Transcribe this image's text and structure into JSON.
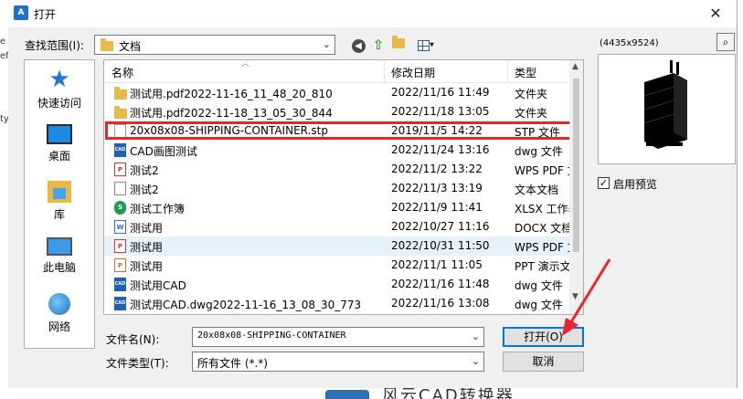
{
  "background": {
    "left_fragments": [
      "e",
      "ef",
      "ty"
    ],
    "bottom_text": "风云CAD转换器"
  },
  "dialog": {
    "title": "打开",
    "app_icon_text": "A"
  },
  "toolbar": {
    "look_in_label": "查找范围(I):",
    "look_in_value": "文档"
  },
  "places": [
    {
      "label": "快速访问",
      "icon": "star-icon"
    },
    {
      "label": "桌面",
      "icon": "desktop-icon"
    },
    {
      "label": "库",
      "icon": "library-icon"
    },
    {
      "label": "此电脑",
      "icon": "computer-icon"
    },
    {
      "label": "网络",
      "icon": "network-icon"
    }
  ],
  "columns": {
    "name": "名称",
    "date": "修改日期",
    "type": "类型"
  },
  "files": [
    {
      "name": "测试用.pdf2022-11-16_11_48_20_810",
      "date": "2022/11/16 11:49",
      "type": "文件夹",
      "icon": "folder"
    },
    {
      "name": "测试用.pdf2022-11-18_13_05_30_844",
      "date": "2022/11/18 13:05",
      "type": "文件夹",
      "icon": "folder"
    },
    {
      "name": "20x08x08-SHIPPING-CONTAINER.stp",
      "date": "2019/11/5 14:22",
      "type": "STP 文件",
      "icon": "stp"
    },
    {
      "name": "CAD画图测试",
      "date": "2022/11/24 13:16",
      "type": "dwg 文件",
      "icon": "cad"
    },
    {
      "name": "测试2",
      "date": "2022/11/2 13:22",
      "type": "WPS PDF 文",
      "icon": "pdf"
    },
    {
      "name": "测试2",
      "date": "2022/11/3 13:19",
      "type": "文本文档",
      "icon": "txt"
    },
    {
      "name": "测试工作簿",
      "date": "2022/11/9 11:41",
      "type": "XLSX 工作表",
      "icon": "xls"
    },
    {
      "name": "测试用",
      "date": "2022/10/27 11:16",
      "type": "DOCX 文档",
      "icon": "doc"
    },
    {
      "name": "测试用",
      "date": "2022/10/31 11:50",
      "type": "WPS PDF 文",
      "icon": "pdf"
    },
    {
      "name": "测试用",
      "date": "2022/11/1 11:05",
      "type": "PPT 演示文",
      "icon": "ppt"
    },
    {
      "name": "测试用CAD",
      "date": "2022/11/16 11:48",
      "type": "dwg 文件",
      "icon": "cad"
    },
    {
      "name": "测试用CAD.dwg2022-11-16_13_08_30_773",
      "date": "2022/11/16 13:08",
      "type": "dwg 文件",
      "icon": "cad"
    }
  ],
  "selected_index": 8,
  "highlighted_index": 2,
  "filename": {
    "label": "文件名(N):",
    "value": "20x08x08-SHIPPING-CONTAINER"
  },
  "filetype": {
    "label": "文件类型(T):",
    "value": "所有文件 (*.*)"
  },
  "buttons": {
    "open": "打开(O)",
    "cancel": "取消"
  },
  "preview": {
    "size": "(4435x9524)",
    "enable_label": "启用预览",
    "enabled": true
  },
  "colors": {
    "highlight": "#e8262b",
    "selected_row": "#e5f1fb",
    "accent": "#0078d7"
  }
}
